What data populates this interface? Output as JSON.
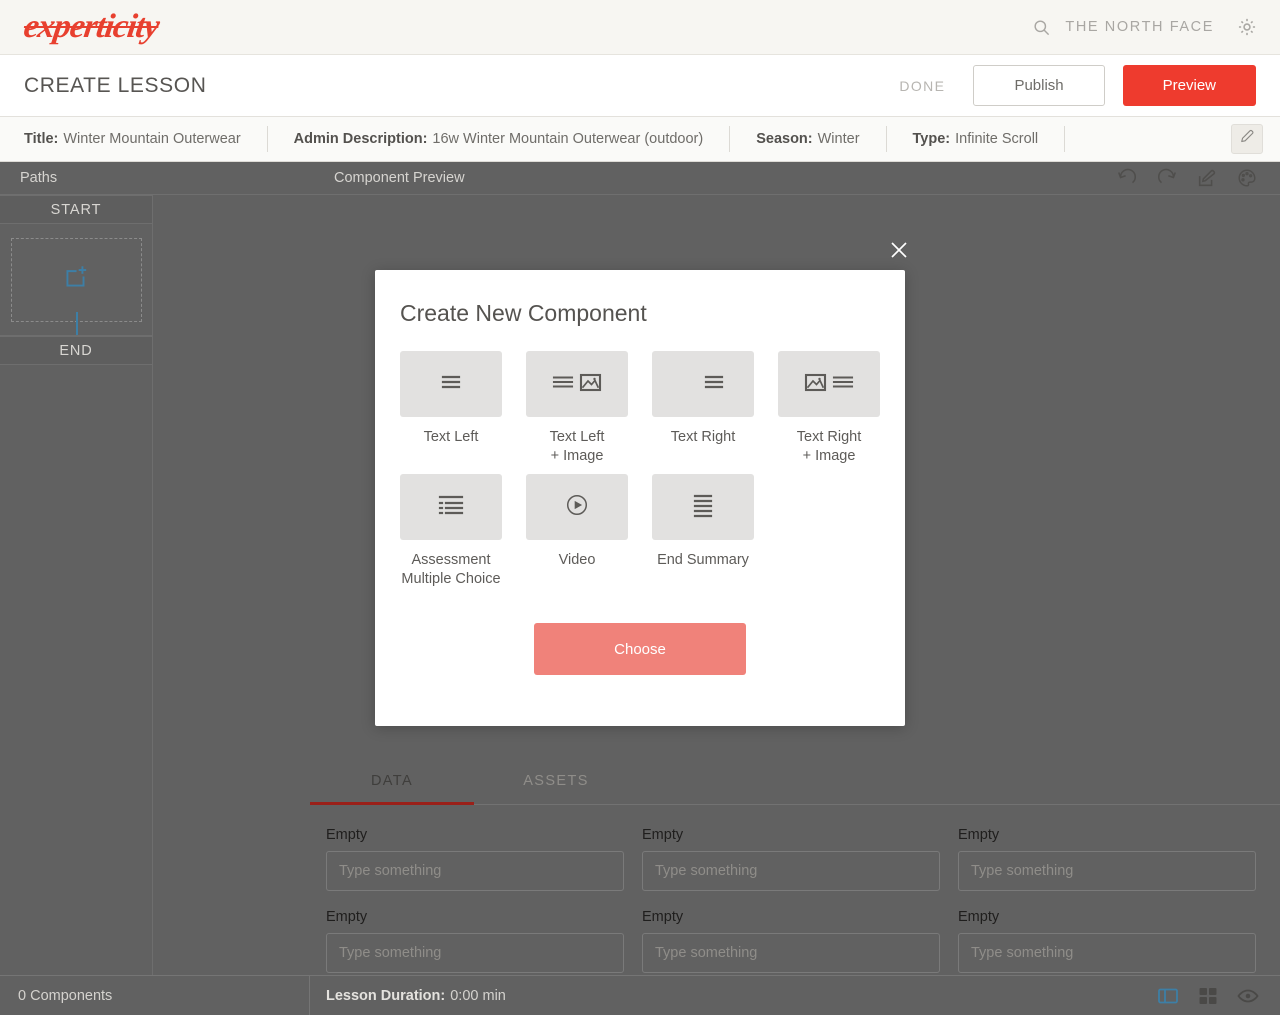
{
  "brand": {
    "logo_text": "experticity",
    "search_icon": "search-icon",
    "account_name": "THE NORTH FACE",
    "settings_icon": "gear-icon"
  },
  "lesson_bar": {
    "page_title": "CREATE LESSON",
    "done_label": "DONE",
    "publish_label": "Publish",
    "preview_label": "Preview",
    "preview_color": "#ee3b2e"
  },
  "meta": {
    "items": [
      {
        "label": "Title:",
        "value": "Winter Mountain Outerwear"
      },
      {
        "label": "Admin Description:",
        "value": "16w Winter Mountain Outerwear (outdoor)"
      },
      {
        "label": "Season:",
        "value": "Winter"
      },
      {
        "label": "Type:",
        "value": "Infinite Scroll"
      }
    ],
    "edit_icon": "pencil-icon"
  },
  "paths": {
    "header": "Paths",
    "start_label": "START",
    "end_label": "END",
    "add_icon": "add-component-icon",
    "connector_color": "#3d7fa6"
  },
  "preview": {
    "header": "Component Preview",
    "icons": [
      "undo-icon",
      "redo-icon",
      "edit-icon",
      "palette-icon"
    ]
  },
  "tabs": [
    {
      "label": "DATA",
      "active": true
    },
    {
      "label": "ASSETS",
      "active": false
    }
  ],
  "fields": [
    {
      "label": "Empty",
      "value": "",
      "placeholder": "Type something"
    },
    {
      "label": "Empty",
      "value": "",
      "placeholder": "Type something"
    },
    {
      "label": "Empty",
      "value": "",
      "placeholder": "Type something"
    },
    {
      "label": "Empty",
      "value": "",
      "placeholder": "Type something"
    },
    {
      "label": "Empty",
      "value": "",
      "placeholder": "Type something"
    },
    {
      "label": "Empty",
      "value": "",
      "placeholder": "Type something"
    }
  ],
  "status": {
    "components_count": "0 Components",
    "duration_label": "Lesson Duration:",
    "duration_value": "0:00 min",
    "icons": [
      "panel-layout-icon",
      "grid-layout-icon",
      "eye-icon"
    ],
    "active_icon_color": "#3d7fa6"
  },
  "modal": {
    "title": "Create New Component",
    "close_icon": "close-icon",
    "choose_label": "Choose",
    "choose_color": "#f0827a",
    "tiles": [
      {
        "label": "Text Left",
        "icon": "text-lines-left-icon"
      },
      {
        "label": "Text Left\n+ Image",
        "icon": "text-lines-plus-image-icon"
      },
      {
        "label": "Text Right",
        "icon": "text-lines-right-icon"
      },
      {
        "label": "Text Right\n+ Image",
        "icon": "image-plus-text-lines-icon"
      },
      {
        "label": "Assessment\nMultiple Choice",
        "icon": "bullet-list-icon"
      },
      {
        "label": "Video",
        "icon": "play-circle-icon"
      },
      {
        "label": "End Summary",
        "icon": "text-lines-dense-icon"
      }
    ]
  }
}
